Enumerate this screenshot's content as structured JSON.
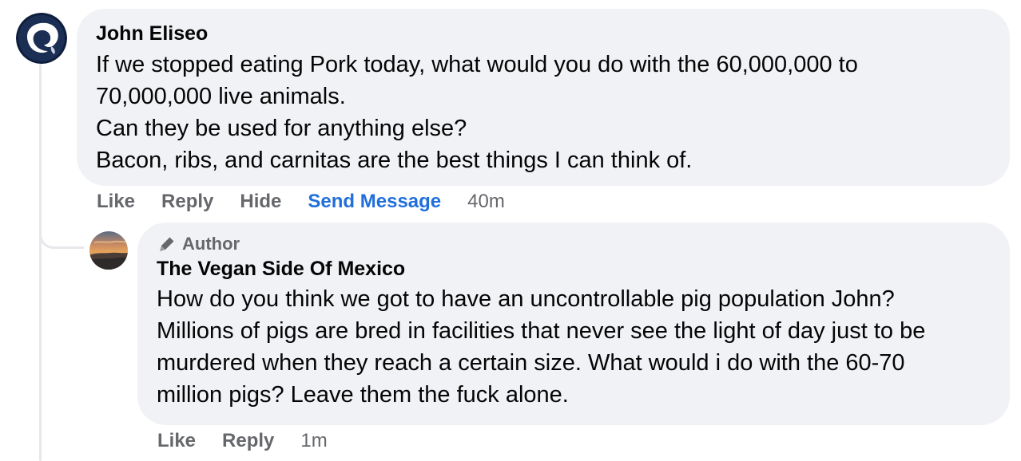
{
  "comments": [
    {
      "author": "John Eliseo",
      "lines": [
        "If we stopped eating Pork today, what would you do with the 60,000,000 to",
        "70,000,000 live animals.",
        "Can they be used for anything else?",
        "Bacon, ribs, and carnitas are the best things I can think of."
      ],
      "actions": {
        "like": "Like",
        "reply": "Reply",
        "hide": "Hide",
        "send_message": "Send Message"
      },
      "time": "40m",
      "avatar_icon": "rams-logo-icon"
    }
  ],
  "reply": {
    "badge": "Author",
    "badge_icon": "pencil-icon",
    "author": "The Vegan Side Of Mexico",
    "lines": [
      "How do you think we got to have an uncontrollable pig population John?",
      "Millions of pigs are bred in facilities that never see the light of day just to be",
      "murdered when they reach a certain size. What would i do with the 60-70",
      "million pigs? Leave them the fuck alone."
    ],
    "actions": {
      "like": "Like",
      "reply": "Reply"
    },
    "time": "1m",
    "avatar_icon": "sunset-landscape-avatar"
  },
  "colors": {
    "bubble_bg": "#f0f2f5",
    "secondary_text": "#65676b",
    "link_blue": "#216fdb",
    "thread_line": "#e6e8ec"
  }
}
